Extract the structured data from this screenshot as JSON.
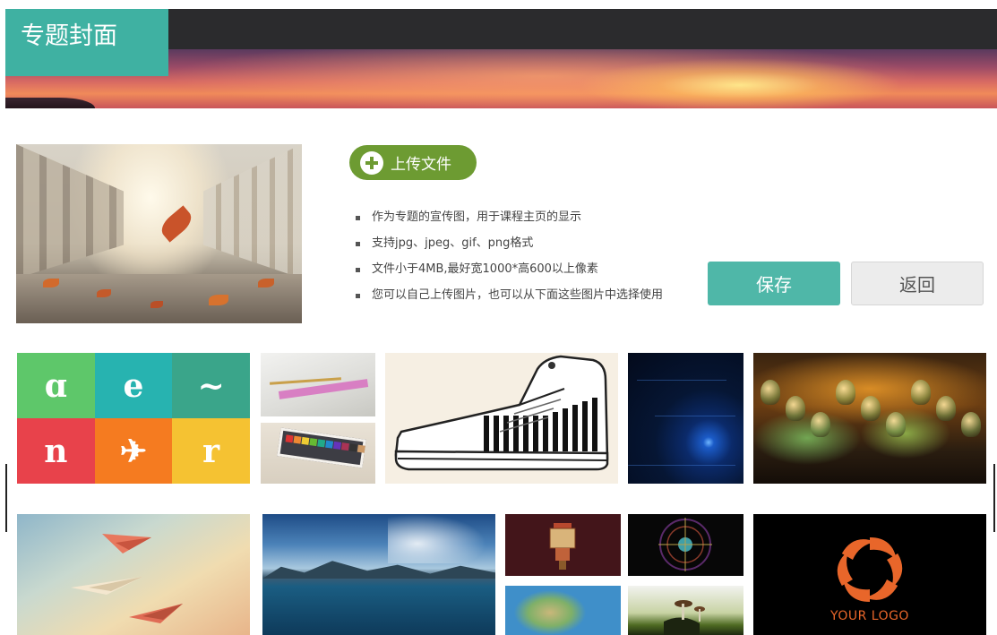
{
  "header": {
    "title": "专题封面"
  },
  "upload": {
    "label": "上传文件",
    "icon": "plus-circle-icon"
  },
  "tips": [
    "作为专题的宣传图，用于课程主页的显示",
    "支持jpg、jpeg、gif、png格式",
    "文件小于4MB,最好宽1000*高600以上像素",
    "您可以自己上传图片，也可以从下面这些图片中选择使用"
  ],
  "actions": {
    "save_label": "保存",
    "back_label": "返回"
  },
  "gallery": {
    "logo_text": "YOUR LOGO",
    "icon_cells": [
      {
        "glyph": "ɑ",
        "color": "#5ec76a"
      },
      {
        "glyph": "e",
        "color": "#27b3b0"
      },
      {
        "glyph": "~",
        "color": "#3aa58a"
      },
      {
        "glyph": "n",
        "color": "#e8424b"
      },
      {
        "glyph": "✈",
        "color": "#f57b20"
      },
      {
        "glyph": "r",
        "color": "#f5c232"
      }
    ]
  },
  "colors": {
    "accent": "#3fb1a2",
    "upload_green": "#6d9b32",
    "save_bg": "#4fb7a8",
    "back_bg": "#ececec"
  }
}
